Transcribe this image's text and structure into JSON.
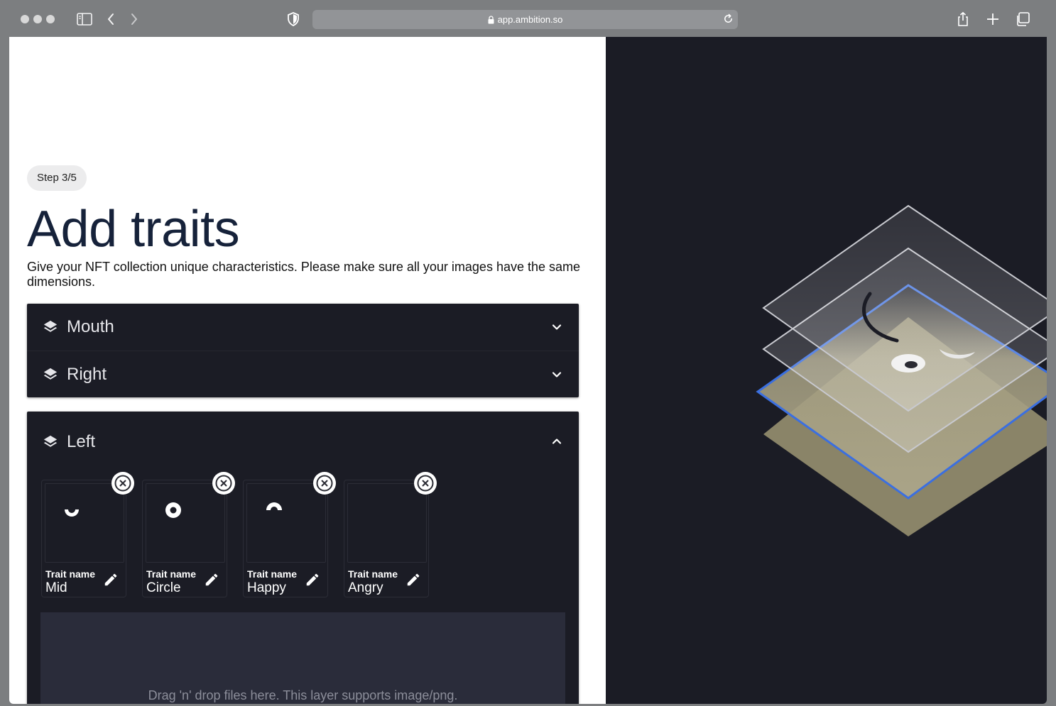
{
  "browser": {
    "url": "app.ambition.so"
  },
  "page": {
    "step_label": "Step 3/5",
    "title": "Add traits",
    "subtitle": "Give your NFT collection unique characteristics. Please make sure all your images have the same dimensions."
  },
  "layers": [
    {
      "name": "Mouth",
      "expanded": false
    },
    {
      "name": "Right",
      "expanded": false
    },
    {
      "name": "Left",
      "expanded": true
    }
  ],
  "traits": [
    {
      "caption": "Trait name",
      "value": "Mid",
      "icon": "eye-mid-icon"
    },
    {
      "caption": "Trait name",
      "value": "Circle",
      "icon": "eye-circle-icon"
    },
    {
      "caption": "Trait name",
      "value": "Happy",
      "icon": "eye-happy-icon"
    },
    {
      "caption": "Trait name",
      "value": "Angry",
      "icon": "eye-angry-icon"
    }
  ],
  "dropzone": {
    "text": "Drag 'n' drop files here. This layer supports image/png."
  },
  "colors": {
    "panel_dark": "#1b1c25",
    "accent_blue": "#3b6fe0",
    "layer_tan": "#8a8468"
  }
}
